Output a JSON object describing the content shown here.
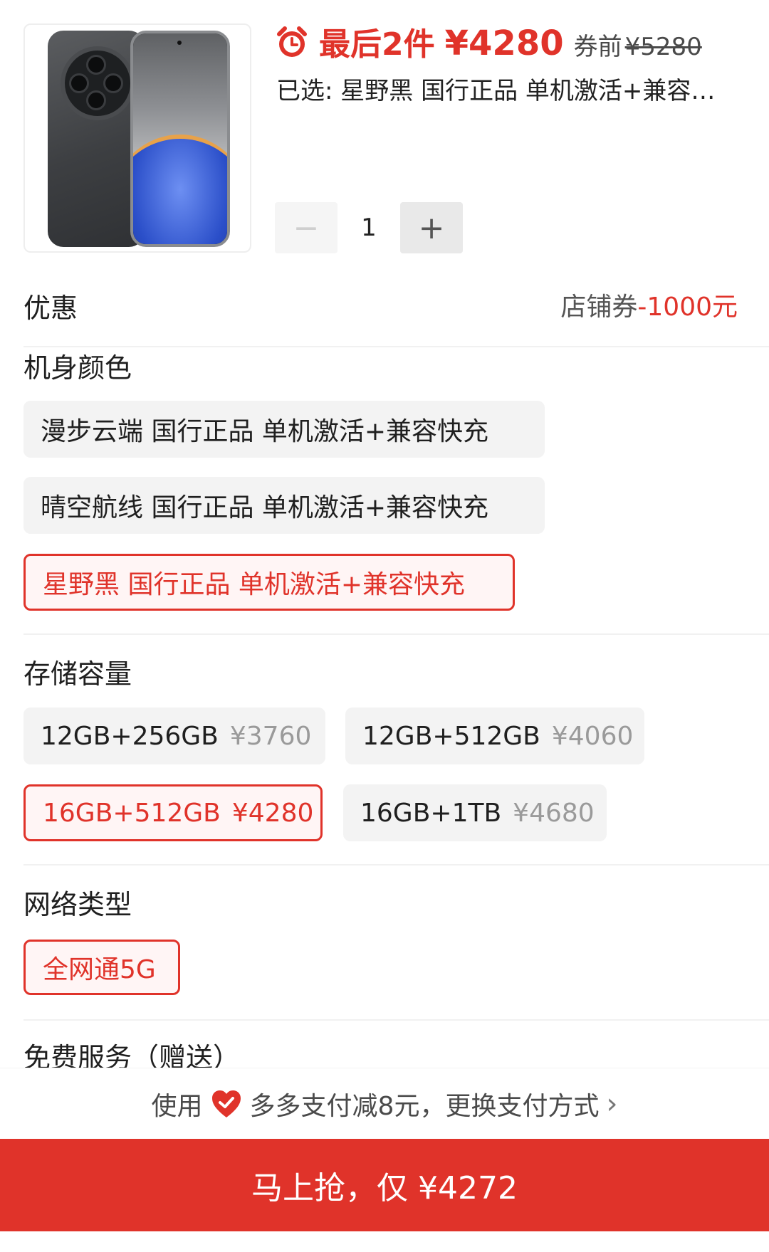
{
  "product": {
    "scarcity": "最后2件",
    "price": "¥4280",
    "before_coupon_label": "券前",
    "original_price": "¥5280",
    "selected_summary": "已选: 星野黑 国行正品 单机激活+兼容快充"
  },
  "quantity": {
    "minus": "−",
    "value": "1",
    "plus": "+"
  },
  "promo": {
    "title": "优惠",
    "label": "店铺券",
    "amount": "-1000元"
  },
  "color_section": {
    "title": "机身颜色",
    "options": [
      {
        "label": "漫步云端 国行正品 单机激活+兼容快充",
        "selected": false
      },
      {
        "label": "晴空航线 国行正品 单机激活+兼容快充",
        "selected": false
      },
      {
        "label": "星野黑 国行正品 单机激活+兼容快充",
        "selected": true
      }
    ]
  },
  "storage_section": {
    "title": "存储容量",
    "options": [
      {
        "label": "12GB+256GB",
        "price": "¥3760",
        "selected": false
      },
      {
        "label": "12GB+512GB",
        "price": "¥4060",
        "selected": false
      },
      {
        "label": "16GB+512GB",
        "price": "¥4280",
        "selected": true
      },
      {
        "label": "16GB+1TB",
        "price": "¥4680",
        "selected": false
      }
    ]
  },
  "network_section": {
    "title": "网络类型",
    "options": [
      {
        "label": "全网通5G",
        "selected": true
      }
    ]
  },
  "services_section": {
    "title": "免费服务（赠送）"
  },
  "payment": {
    "prefix": "使用",
    "text": "多多支付减8元，更换支付方式"
  },
  "buy_button": {
    "label": "马上抢，仅 ¥4272"
  },
  "colors": {
    "accent": "#e0332a"
  }
}
